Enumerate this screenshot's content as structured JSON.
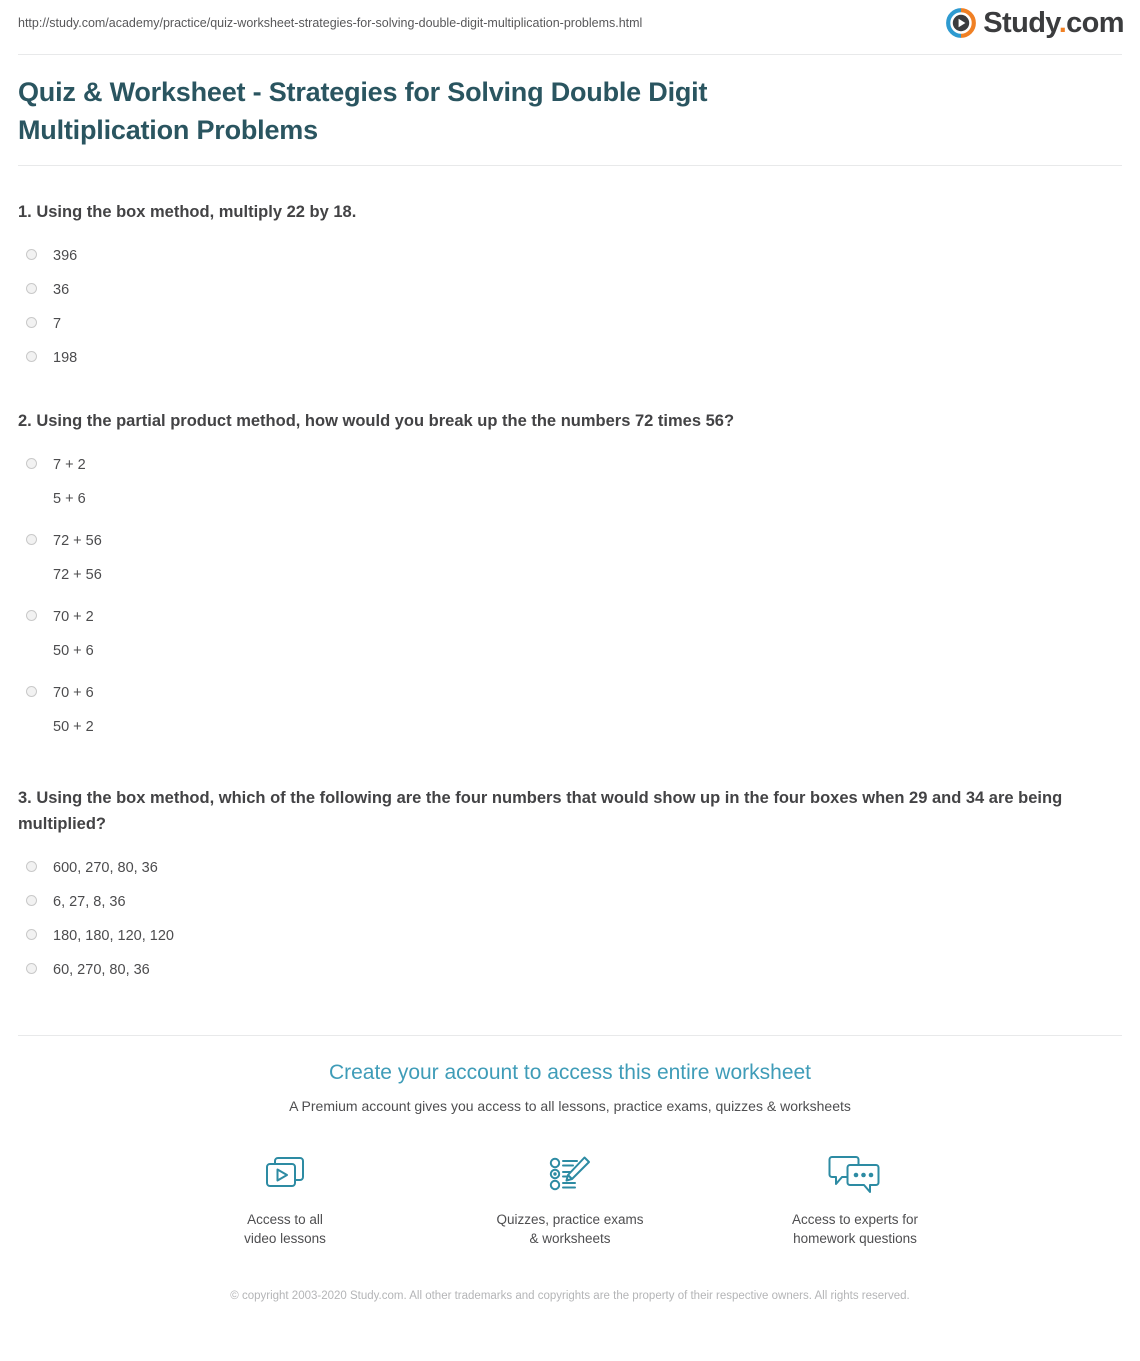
{
  "header": {
    "url": "http://study.com/academy/practice/quiz-worksheet-strategies-for-solving-double-digit-multiplication-problems.html",
    "logo": {
      "icon": "play-circle-icon",
      "brand": "Study",
      "dot": ".",
      "tld": "com",
      "ring_left_color": "#2e9ad0",
      "ring_right_color": "#f08024",
      "text_color": "#3b3c3e"
    }
  },
  "page_title": "Quiz & Worksheet - Strategies for Solving Double Digit Multiplication Problems",
  "questions": [
    {
      "number": "1.",
      "text": "1. Using the box method, multiply 22 by 18.",
      "options": [
        {
          "line1": "396",
          "line2": ""
        },
        {
          "line1": "36",
          "line2": ""
        },
        {
          "line1": "7",
          "line2": ""
        },
        {
          "line1": "198",
          "line2": ""
        }
      ]
    },
    {
      "number": "2.",
      "text": "2. Using the partial product method, how would you break up the the numbers 72 times 56?",
      "options": [
        {
          "line1": "7 + 2",
          "line2": "5 + 6"
        },
        {
          "line1": "72 + 56",
          "line2": "72 + 56"
        },
        {
          "line1": "70 + 2",
          "line2": "50 + 6"
        },
        {
          "line1": "70 + 6",
          "line2": "50 + 2"
        }
      ]
    },
    {
      "number": "3.",
      "text": "3. Using the box method, which of the following are the four numbers that would show up in the four boxes when 29 and 34 are being multiplied?",
      "options": [
        {
          "line1": "600, 270, 80, 36",
          "line2": ""
        },
        {
          "line1": "6, 27, 8, 36",
          "line2": ""
        },
        {
          "line1": "180, 180, 120, 120",
          "line2": ""
        },
        {
          "line1": "60, 270, 80, 36",
          "line2": ""
        }
      ]
    }
  ],
  "cta": {
    "heading": "Create your account to access this entire worksheet",
    "subheading": "A Premium account gives you access to all lessons, practice exams, quizzes & worksheets",
    "accent_color": "#3f9cb8",
    "icon_color": "#2d8ba3",
    "features": [
      {
        "icon": "video-lessons-icon",
        "label_line1": "Access to all",
        "label_line2": "video lessons"
      },
      {
        "icon": "quiz-pencil-icon",
        "label_line1": "Quizzes, practice exams",
        "label_line2": "& worksheets"
      },
      {
        "icon": "chat-bubbles-icon",
        "label_line1": "Access to experts for",
        "label_line2": "homework questions"
      }
    ]
  },
  "footer": {
    "copyright": "© copyright 2003-2020 Study.com. All other trademarks and copyrights are the property of their respective owners. All rights reserved."
  }
}
